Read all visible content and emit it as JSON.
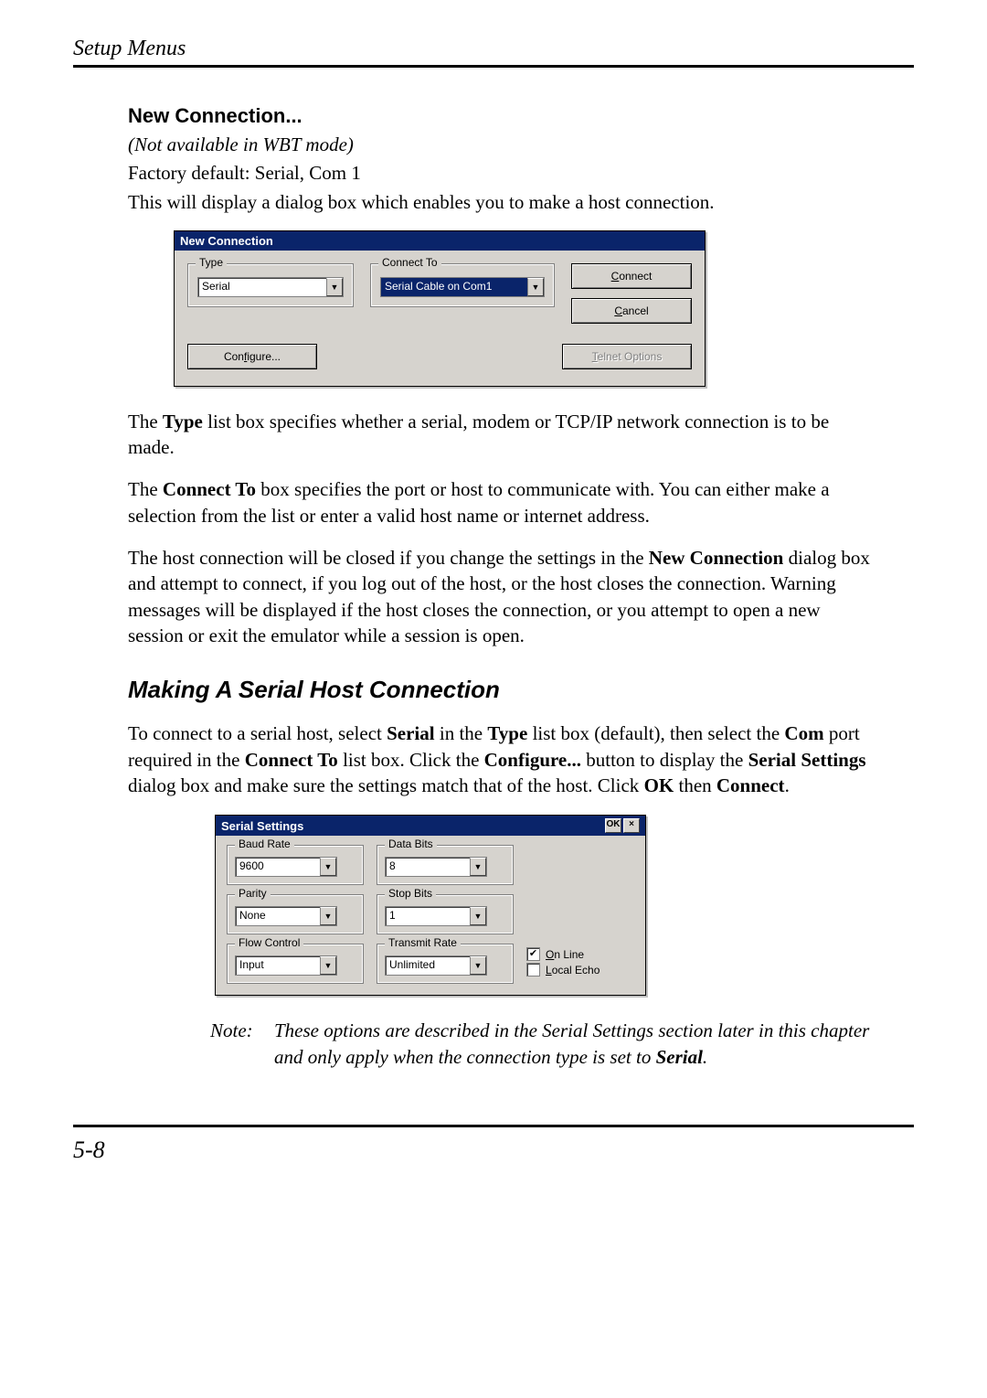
{
  "header": "Setup Menus",
  "section_title": "New Connection...",
  "subtitle_italic": "(Not available in WBT mode)",
  "factory_default": "Factory default: Serial, Com 1",
  "intro_line": "This will display a dialog box which enables you to make a host connection.",
  "dlg1": {
    "title": "New Connection",
    "group_type_label": "Type",
    "type_value": "Serial",
    "group_connect_label": "Connect To",
    "connect_to_value": "Serial Cable on Com1",
    "btn_connect_pre": "C",
    "btn_connect_post": "onnect",
    "btn_cancel_pre": "C",
    "btn_cancel_post": "ancel",
    "btn_configure_pre": "Con",
    "btn_configure_mid": "f",
    "btn_configure_post": "igure...",
    "btn_telnet_pre": "T",
    "btn_telnet_post": "elnet Options"
  },
  "para1_pre": "The ",
  "para1_b1": "Type",
  "para1_post": " list box specifies whether a serial, modem or TCP/IP network connection is to be made.",
  "para2_pre": "The ",
  "para2_b1": "Connect To",
  "para2_post": " box specifies the port or host to communicate with. You can either make a selection from the list or enter a valid host name or internet address.",
  "para3_pre": "The host connection will be closed if you change the settings in the ",
  "para3_b1": "New Connection",
  "para3_post": " dialog box and attempt to connect, if you log out of the host, or the host closes the connection. Warning messages will be displayed if the host closes the connection, or you attempt to open a new session or exit the emulator while a session is open.",
  "subsection": "Making A Serial Host Connection",
  "para4_pre": "To connect to a serial host, select ",
  "para4_b1": "Serial",
  "para4_mid1": " in the ",
  "para4_b2": "Type",
  "para4_mid2": " list box (default), then select the ",
  "para4_b3": "Com",
  "para4_mid3": " port required in the ",
  "para4_b4": "Connect To",
  "para4_mid4": " list box. Click the ",
  "para4_b5": "Configure...",
  "para4_mid5": " button to display the ",
  "para4_b6": "Serial Settings",
  "para4_mid6": " dialog box and make sure the settings match that of the host. Click ",
  "para4_b7": "OK",
  "para4_mid7": " then ",
  "para4_b8": "Connect",
  "para4_post": ".",
  "dlg2": {
    "title": "Serial Settings",
    "ok_label": "OK",
    "baud_label": "Baud Rate",
    "baud_value": "9600",
    "databits_label": "Data Bits",
    "databits_value": "8",
    "parity_label": "Parity",
    "parity_value": "None",
    "stopbits_label": "Stop Bits",
    "stopbits_value": "1",
    "flow_label": "Flow Control",
    "flow_value": "Input",
    "tx_label": "Transmit Rate",
    "tx_value": "Unlimited",
    "online_pre": "O",
    "online_post": "n Line",
    "localecho_pre": "L",
    "localecho_post": "ocal Echo"
  },
  "note_label": "Note:",
  "note_body_pre": "These options are described in the Serial Settings section later in this chapter and only apply when the connection type is set to ",
  "note_body_b": "Serial",
  "note_body_post": ".",
  "page_number": "5-8"
}
